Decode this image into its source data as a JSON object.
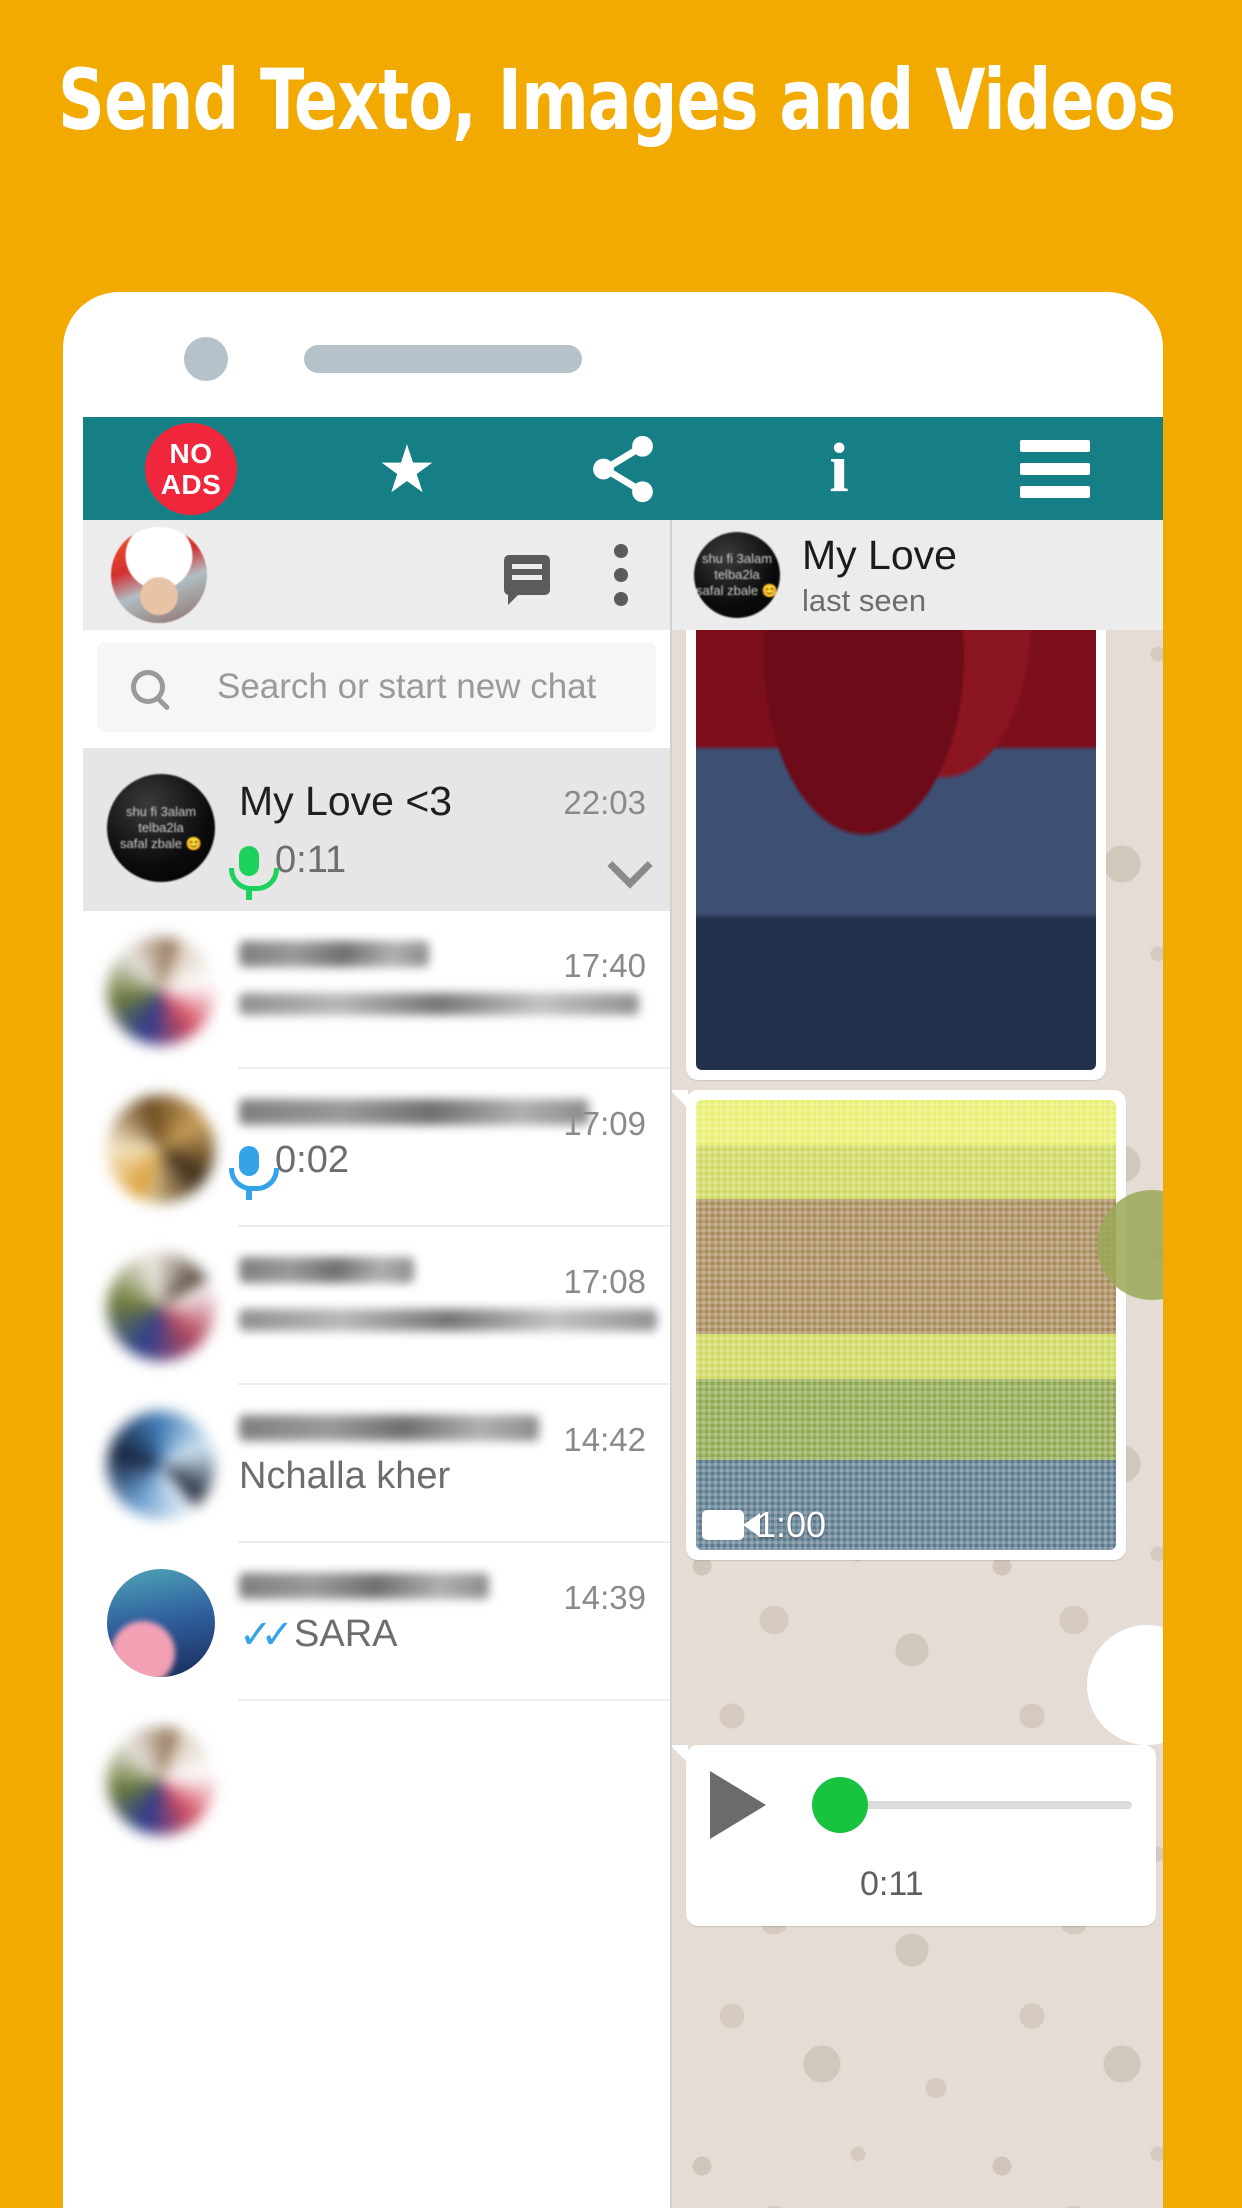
{
  "headline": "Send Texto, Images and Videos",
  "colors": {
    "background": "#F2A900",
    "appbar": "#167F86",
    "badge_red": "#F0273C",
    "mic_unplayed": "#1DD15D",
    "mic_played": "#34A3E8",
    "read_check": "#34A3E8",
    "wallpaper": "#E5DDD5"
  },
  "appbar": {
    "items": [
      {
        "icon": "no-ads-badge",
        "line1": "NO",
        "line2": "ADS"
      },
      {
        "icon": "star-icon",
        "glyph": "★"
      },
      {
        "icon": "share-icon"
      },
      {
        "icon": "info-icon",
        "glyph": "i"
      },
      {
        "icon": "hamburger-menu-icon"
      }
    ]
  },
  "chat_list": {
    "header": {
      "avatar": "my-profile-avatar",
      "new_chat_icon": "chat-bubble-icon",
      "overflow_icon": "more-vertical-icon"
    },
    "search": {
      "icon": "search-icon",
      "placeholder": "Search or start new chat",
      "value": ""
    },
    "rows": [
      {
        "name": "My Love <3",
        "name_blurred": false,
        "avatar": "avatar-my-love",
        "avatar_text": [
          "shu fi 3alam",
          "telba2la",
          "safal zbale 😊"
        ],
        "preview": "0:11",
        "preview_blurred": false,
        "preview_icon": "mic-icon",
        "preview_icon_state": "unplayed",
        "time": "22:03",
        "trailing_icon": "chevron-down-icon",
        "active": true
      },
      {
        "name": "",
        "name_blurred": true,
        "avatar": "avatar-contact-2",
        "preview": "",
        "preview_blurred": true,
        "preview_icon": "",
        "time": "17:40",
        "trailing_icon": "",
        "active": false
      },
      {
        "name": "",
        "name_blurred": true,
        "avatar": "avatar-contact-3",
        "preview": "0:02",
        "preview_blurred": false,
        "preview_icon": "mic-icon",
        "preview_icon_state": "played",
        "time": "17:09",
        "trailing_icon": "",
        "active": false
      },
      {
        "name": "",
        "name_blurred": true,
        "avatar": "avatar-contact-4",
        "preview": "",
        "preview_blurred": true,
        "preview_icon": "",
        "time": "17:08",
        "trailing_icon": "",
        "active": false
      },
      {
        "name": "",
        "name_blurred": true,
        "avatar": "avatar-contact-5",
        "preview": "Nchalla kher",
        "preview_blurred": false,
        "preview_icon": "",
        "time": "14:42",
        "trailing_icon": "",
        "active": false
      },
      {
        "name": "",
        "name_blurred": true,
        "avatar": "avatar-contact-6",
        "preview": "SARA",
        "preview_blurred": false,
        "preview_icon": "double-check-icon",
        "preview_icon_state": "read",
        "time": "14:39",
        "trailing_icon": "",
        "active": false
      }
    ]
  },
  "conversation": {
    "header": {
      "avatar": "avatar-my-love",
      "title": "My Love",
      "status": "last seen"
    },
    "messages": [
      {
        "type": "image",
        "name": "photo-message-roses"
      },
      {
        "type": "video",
        "name": "video-message",
        "duration": "1:00",
        "icon": "video-camera-icon"
      },
      {
        "type": "voice",
        "name": "voice-message",
        "duration": "0:11",
        "play_icon": "play-icon",
        "progress": 0
      }
    ]
  }
}
